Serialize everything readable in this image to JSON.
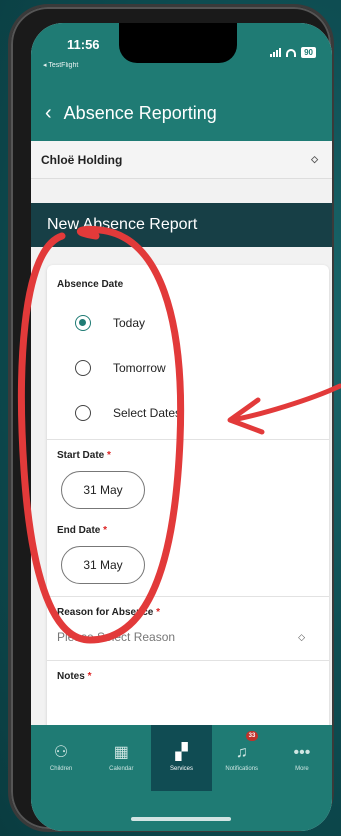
{
  "status": {
    "time": "11:56",
    "back_app": "◂ TestFlight",
    "battery": "90"
  },
  "navbar": {
    "title": "Absence Reporting",
    "back_glyph": "‹"
  },
  "child_select": {
    "value": "Chloë Holding"
  },
  "report_header": {
    "title": "New Absence Report"
  },
  "form": {
    "absence_date_label": "Absence Date",
    "options": [
      {
        "label": "Today",
        "selected": true
      },
      {
        "label": "Tomorrow",
        "selected": false
      },
      {
        "label": "Select Dates",
        "selected": false
      }
    ],
    "start_date_label": "Start Date",
    "start_date_value": "31 May",
    "end_date_label": "End Date",
    "end_date_value": "31 May",
    "reason_label": "Reason for Absence",
    "reason_placeholder": "Please Select Reason",
    "notes_label": "Notes",
    "required_mark": "*"
  },
  "tabbar": {
    "tabs": [
      {
        "label": "Children",
        "icon": "children-icon"
      },
      {
        "label": "Calendar",
        "icon": "calendar-icon"
      },
      {
        "label": "Services",
        "icon": "services-icon",
        "active": true
      },
      {
        "label": "Notifications",
        "icon": "bell-icon",
        "badge": "33"
      },
      {
        "label": "More",
        "icon": "more-icon"
      }
    ]
  },
  "colors": {
    "accent": "#1f7b74",
    "header_dark": "#173f46",
    "annotation": "#e23a3a"
  }
}
